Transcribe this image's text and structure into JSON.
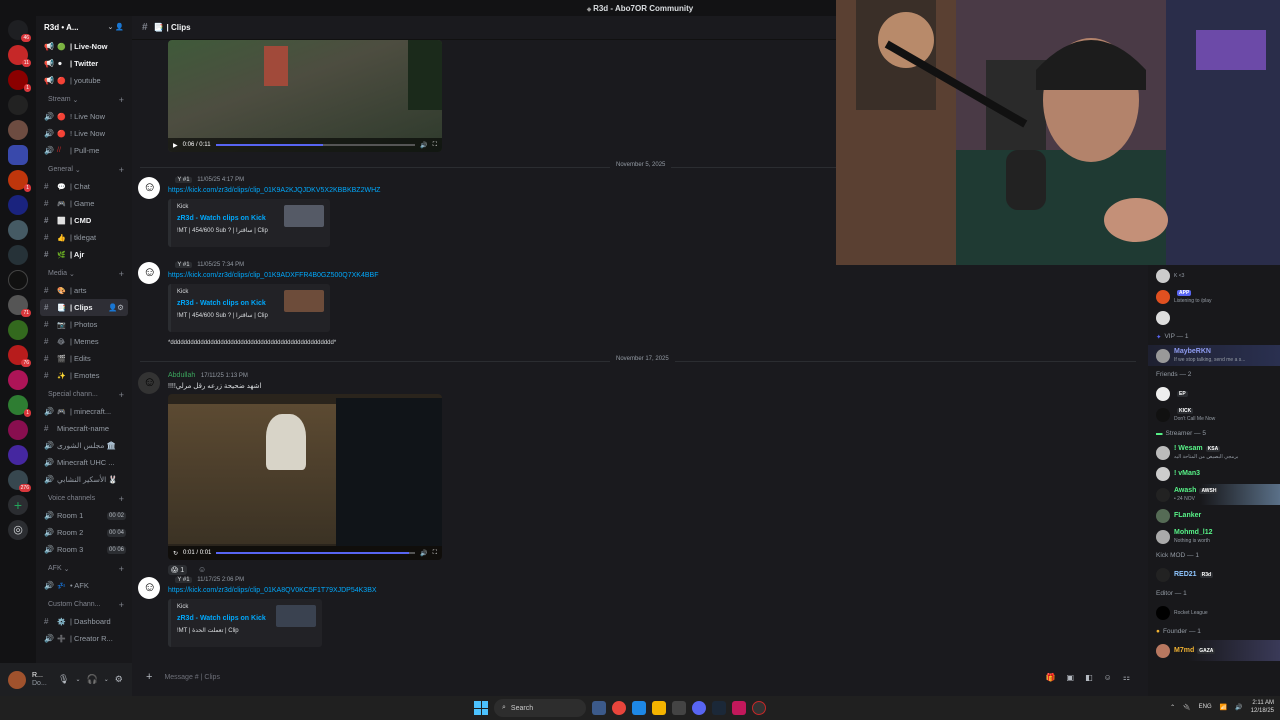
{
  "window": {
    "title": "R3d - Abo7OR Community"
  },
  "server_rail": {
    "badges": [
      "46",
      "11",
      "1",
      "1",
      "71",
      "76",
      "1",
      "276"
    ]
  },
  "guild": {
    "name": "R3d • A..."
  },
  "channels": {
    "top": [
      {
        "label": "| Live-Now",
        "emoji": "🟢",
        "bold": true
      },
      {
        "label": "| Twitter",
        "emoji": "⚫",
        "bold": true
      },
      {
        "label": "| youtube",
        "emoji": "🔴",
        "bold": false
      }
    ],
    "stream_category": "Stream",
    "stream": [
      {
        "label": "! Live Now",
        "emoji": "🔴"
      },
      {
        "label": "! Live Now",
        "emoji": "🔴"
      },
      {
        "label": "| Pull-me",
        "emoji": "//"
      }
    ],
    "general_category": "General",
    "general": [
      {
        "label": "| Chat",
        "emoji": "💬",
        "bold": false
      },
      {
        "label": "| Game",
        "emoji": "🎮",
        "bold": false
      },
      {
        "label": "| CMD",
        "emoji": "⬜",
        "bold": true
      },
      {
        "label": "| tklegat",
        "emoji": "👍",
        "bold": false
      },
      {
        "label": "| Ajr",
        "emoji": "🌿",
        "bold": true
      }
    ],
    "media_category": "Media",
    "media": [
      {
        "label": "| arts",
        "emoji": "🎨",
        "active": false
      },
      {
        "label": "| Clips",
        "emoji": "📑",
        "active": true
      },
      {
        "label": "| Photos",
        "emoji": "📷",
        "active": false
      },
      {
        "label": "| Memes",
        "emoji": "😂",
        "active": false
      },
      {
        "label": "| Edits",
        "emoji": "🎬",
        "active": false
      },
      {
        "label": "| Emotes",
        "emoji": "✨",
        "active": false
      }
    ],
    "special_category": "Special chann...",
    "special": [
      {
        "label": "| minecraft...",
        "emoji": "🎮",
        "icon": "speaker"
      },
      {
        "label": "Minecraft-name",
        "emoji": "",
        "icon": "hash"
      },
      {
        "label": "مجلس الشورى 🏛️",
        "emoji": "",
        "icon": "speaker"
      },
      {
        "label": "Minecraft UHC ...",
        "emoji": "",
        "icon": "speaker"
      },
      {
        "label": "الأسكير النشابي 🐰",
        "emoji": "",
        "icon": "speaker"
      }
    ],
    "voice_category": "Voice channels",
    "voice": [
      {
        "label": "Room 1",
        "count": "00 02"
      },
      {
        "label": "Room 2",
        "count": "00 04"
      },
      {
        "label": "Room 3",
        "count": "00 06"
      }
    ],
    "afk_category": "AFK",
    "afk": [
      {
        "label": "• AFK",
        "emoji": "💤"
      }
    ],
    "custom_category": "Custom Chann...",
    "custom": [
      {
        "label": "| Dashboard",
        "emoji": "⚙️",
        "icon": "hash"
      },
      {
        "label": "| Creator R...",
        "emoji": "➕",
        "icon": "speaker"
      }
    ]
  },
  "user_panel": {
    "name": "R...",
    "status": "Do..."
  },
  "chat": {
    "channel_name": "| Clips",
    "video1": {
      "time": "0:06 / 0:11",
      "progress": 0.54
    },
    "dividers": [
      "November 5, 2025",
      "November 17, 2025"
    ],
    "messages": [
      {
        "tag": "Y #1",
        "time": "11/05/25 4:17 PM",
        "link": "https://kick.com/zr3d/clips/clip_01K9A2KJQJDKV5X2KBBKBZ2WHZ",
        "card": {
          "provider": "Kick",
          "title": "zR3d - Watch clips on Kick",
          "desc": "!MT | 454/600 Sub ? | ساقترا | Clip"
        }
      },
      {
        "tag": "Y #1",
        "time": "11/05/25 7:34 PM",
        "link": "https://kick.com/zr3d/clips/clip_01K9ADXFFR4B0GZ500Q7XK4BBF",
        "card": {
          "provider": "Kick",
          "title": "zR3d - Watch clips on Kick",
          "desc": "!MT | 454/600 Sub ? | ساقترا | Clip"
        },
        "extra": "*ddddddddddddddddddddddddddddddddddddddddddddddddd*"
      },
      {
        "author": "Abdullah",
        "time": "17/11/25 1:13 PM",
        "text": "!!!!اشهد ضحيحة زرعه رقل مرلي",
        "video_time": "0:01 / 0:01",
        "video_progress": 0.97,
        "reaction": "😱 1"
      },
      {
        "tag": "Y #1",
        "time": "11/17/25 2:06 PM",
        "link": "https://kick.com/zr3d/clips/clip_01KA8QV0KC5F1T79XJDP54K3BX",
        "card": {
          "provider": "Kick",
          "title": "zR3d - Watch clips on Kick",
          "desc": "!MT | تعملت الحدة | Clip"
        }
      }
    ],
    "composer_placeholder": "Message #  | Clips"
  },
  "members": {
    "top": [
      {
        "name": "",
        "sub": "K <3"
      },
      {
        "name": "",
        "sub": "Listening to /play",
        "badge": "APP"
      },
      {
        "name": "",
        "sub": ""
      }
    ],
    "vip_header": "VIP — 1",
    "vip": [
      {
        "name": "MaybeRKN",
        "sub": "If we stop talking, send me a s...",
        "color": "#8e9bf0"
      }
    ],
    "friends_header": "Friends — 2",
    "friends": [
      {
        "name": "",
        "sub": "",
        "badge": "EP"
      },
      {
        "name": "",
        "sub": "Don't Call Me Now",
        "badge": "KICK"
      }
    ],
    "streamer_header": "Streamer — 5",
    "streamers": [
      {
        "name": "! Wesam",
        "sub": "برمجي البصيص من المتاحة اليه",
        "badge": "KSA",
        "color": "#57f287"
      },
      {
        "name": "! vMan3",
        "sub": "",
        "color": "#57f287"
      },
      {
        "name": "Awash",
        "sub": "• 24 NOV",
        "badge": "AWSH",
        "color": "#57f287"
      },
      {
        "name": "FLanker",
        "sub": "",
        "color": "#57f287"
      },
      {
        "name": "Mohmd_l12",
        "sub": "Nothing is worth",
        "color": "#57f287"
      }
    ],
    "kickmod_header": "Kick MOD — 1",
    "kickmod": [
      {
        "name": "RED21",
        "sub": "",
        "badge": "R3d",
        "color": "#8ec5ff"
      }
    ],
    "editor_header": "Editor — 1",
    "editor": [
      {
        "name": "",
        "sub": "Rocket League"
      }
    ],
    "founder_header": "Founder — 1",
    "founder": [
      {
        "name": "M7md",
        "sub": "",
        "badge": "GAZA",
        "color": "#f0b232"
      }
    ]
  },
  "taskbar": {
    "search": "Search",
    "lang": "ENG",
    "time": "2:11 AM",
    "date": "12/18/25"
  },
  "colors": {
    "accent": "#5865f2",
    "link": "#00a8fc",
    "online": "#23a55a"
  }
}
